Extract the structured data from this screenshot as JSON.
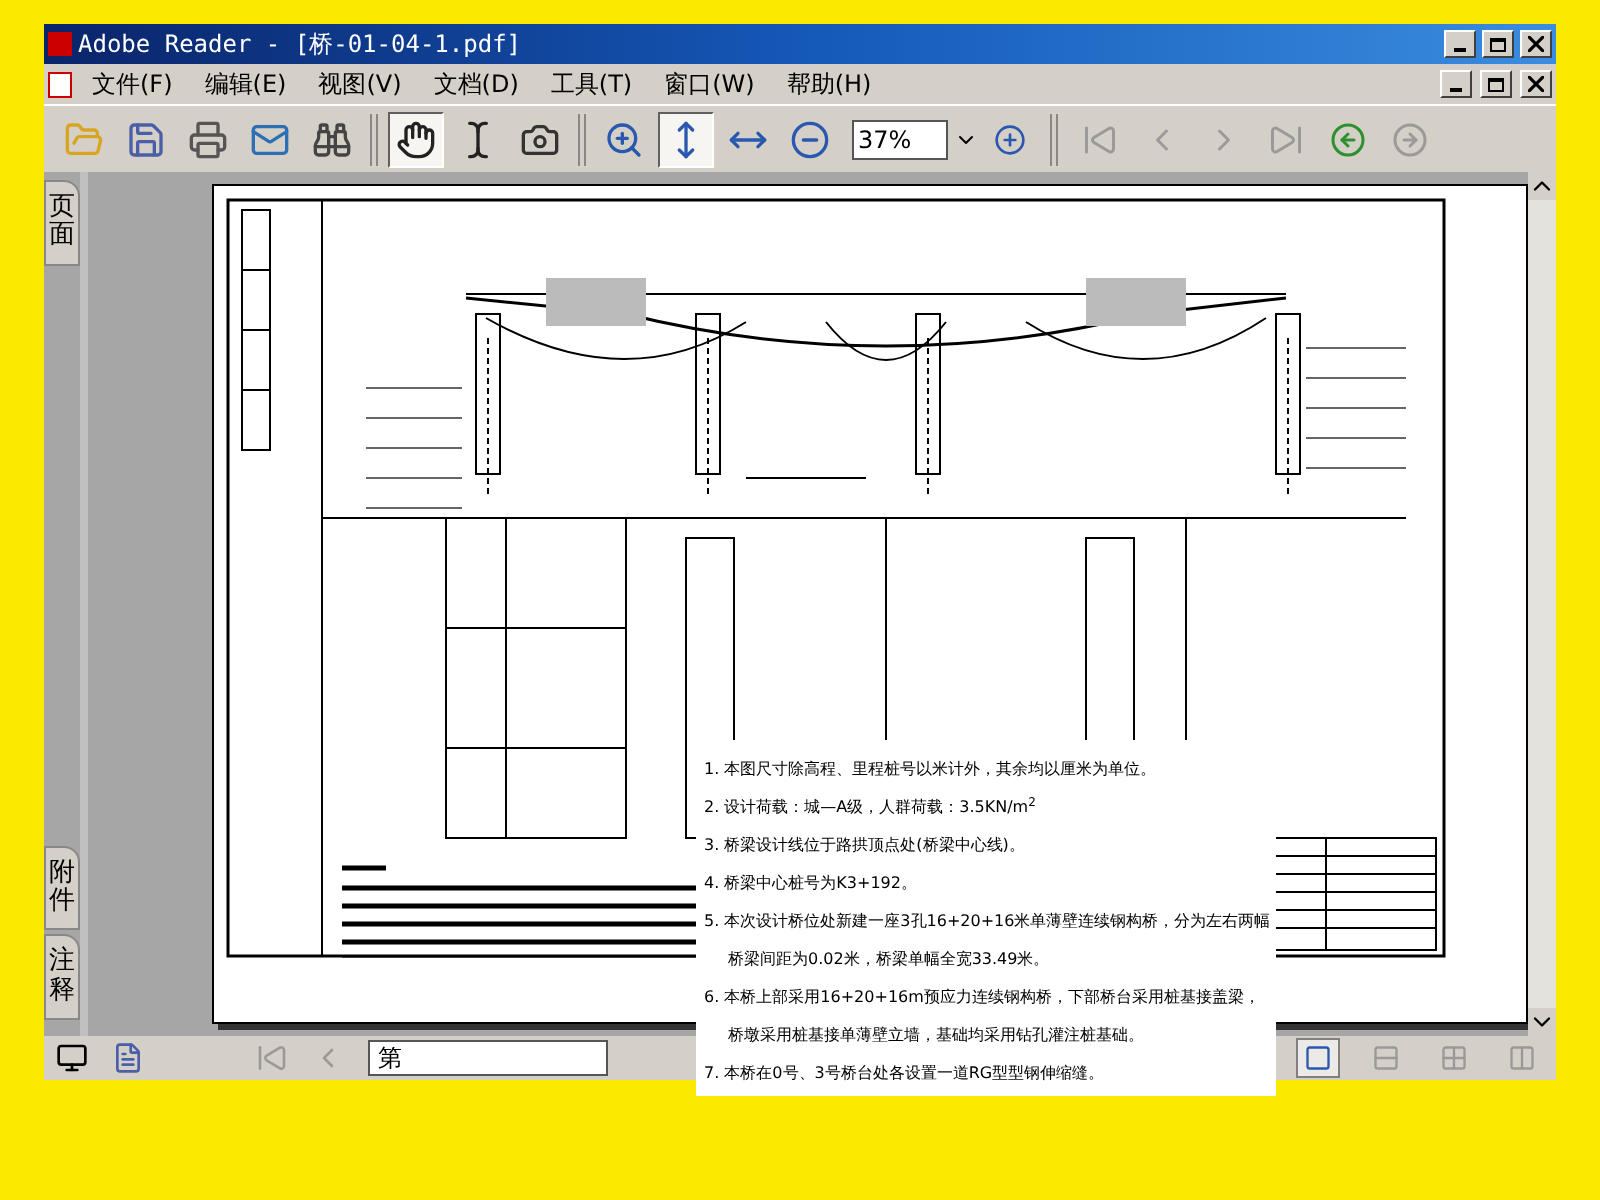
{
  "window": {
    "title": "Adobe Reader - [桥-01-04-1.pdf]"
  },
  "menu": [
    "文件(F)",
    "编辑(E)",
    "视图(V)",
    "文档(D)",
    "工具(T)",
    "窗口(W)",
    "帮助(H)"
  ],
  "toolbar": {
    "tool_groups": [
      [
        {
          "kind": "open",
          "selected": false
        },
        {
          "kind": "save",
          "selected": false
        },
        {
          "kind": "print",
          "selected": false
        },
        {
          "kind": "email",
          "selected": false
        },
        {
          "kind": "search",
          "selected": false
        }
      ],
      [
        {
          "kind": "hand",
          "selected": true
        },
        {
          "kind": "select",
          "selected": false
        },
        {
          "kind": "snapshot",
          "selected": false
        }
      ],
      [
        {
          "kind": "zoomin",
          "selected": false
        },
        {
          "kind": "fitpage",
          "selected": true
        },
        {
          "kind": "fitwidth",
          "selected": false
        },
        {
          "kind": "minus",
          "selected": false
        }
      ]
    ],
    "zoom": "37%",
    "nav": [
      {
        "kind": "first",
        "disabled": true
      },
      {
        "kind": "prev",
        "disabled": true
      },
      {
        "kind": "next",
        "disabled": true
      },
      {
        "kind": "last",
        "disabled": true
      },
      {
        "kind": "back",
        "disabled": false
      },
      {
        "kind": "forward",
        "disabled": true
      }
    ]
  },
  "side_tabs": [
    {
      "label": "页面"
    },
    {
      "label": "附件"
    },
    {
      "label": "注释"
    }
  ],
  "notes": [
    "1. 本图尺寸除高程、里程桩号以米计外，其余均以厘米为单位。",
    "2. 设计荷载：城—A级，人群荷载：3.5KN/m$^{2}$",
    "3. 桥梁设计线位于路拱顶点处(桥梁中心线)。",
    "4. 桥梁中心桩号为K3+192。",
    "5. 本次设计桥位处新建一座3孔16+20+16米单薄壁连续钢构桥，分为左右两幅",
    "桥梁间距为0.02米，桥梁单幅全宽33.49米。",
    "6. 本桥上部采用16+20+16m预应力连续钢构桥，下部桥台采用桩基接盖梁，",
    "桥墩采用桩基接单薄壁立墙，基础均采用钻孔灌注桩基础。",
    "7. 本桥在0号、3号桥台处各设置一道RG型型钢伸缩缝。"
  ],
  "status_bar": {
    "page_field": "第",
    "layouts": [
      {
        "selected": true
      },
      {
        "selected": false
      },
      {
        "selected": false
      },
      {
        "selected": false
      }
    ]
  }
}
